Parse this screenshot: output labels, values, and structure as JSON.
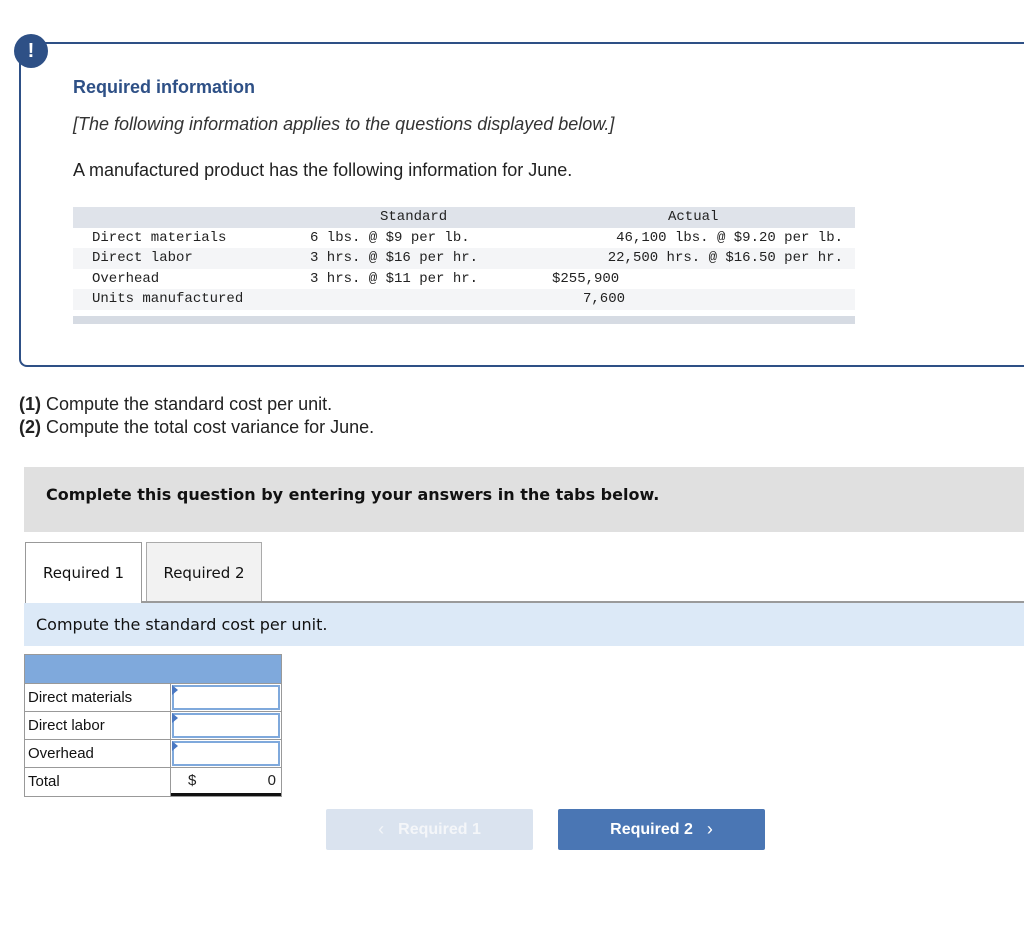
{
  "info": {
    "badge_glyph": "!",
    "title": "Required information",
    "subtitle": "[The following information applies to the questions displayed below.]",
    "intro": "A manufactured product has the following information for June."
  },
  "data_table": {
    "headers": {
      "standard": "Standard",
      "actual": "Actual"
    },
    "rows": [
      {
        "label": "Direct materials",
        "standard": "6 lbs. @ $9 per lb.",
        "actual": "46,100 lbs. @ $9.20 per lb."
      },
      {
        "label": "Direct labor",
        "standard": "3 hrs. @ $16 per hr.",
        "actual": "22,500 hrs. @ $16.50 per hr."
      },
      {
        "label": "Overhead",
        "standard": "3 hrs. @ $11 per hr.",
        "actual": "$255,900"
      },
      {
        "label": "Units manufactured",
        "standard": "",
        "actual": "7,600"
      }
    ]
  },
  "questions": [
    {
      "num": "(1)",
      "text": " Compute the standard cost per unit."
    },
    {
      "num": "(2)",
      "text": " Compute the total cost variance for June."
    }
  ],
  "instructions": "Complete this question by entering your answers in the tabs below.",
  "tabs": [
    {
      "label": "Required 1",
      "active": true
    },
    {
      "label": "Required 2",
      "active": false
    }
  ],
  "panel": {
    "heading": "Compute the standard cost per unit.",
    "rows": [
      {
        "label": "Direct materials",
        "value": ""
      },
      {
        "label": "Direct labor",
        "value": ""
      },
      {
        "label": "Overhead",
        "value": ""
      }
    ],
    "total": {
      "label": "Total",
      "currency": "$",
      "value": "0"
    }
  },
  "nav": {
    "prev_label": "Required 1",
    "next_label": "Required 2",
    "prev_icon": "chevron-left-icon",
    "next_icon": "chevron-right-icon"
  },
  "colors": {
    "brand_navy": "#2e5086",
    "table_header_blue": "#7fa9dc",
    "panel_blue": "#dce9f7",
    "next_button": "#4a76b4",
    "prev_button_disabled": "#dae3ef"
  }
}
